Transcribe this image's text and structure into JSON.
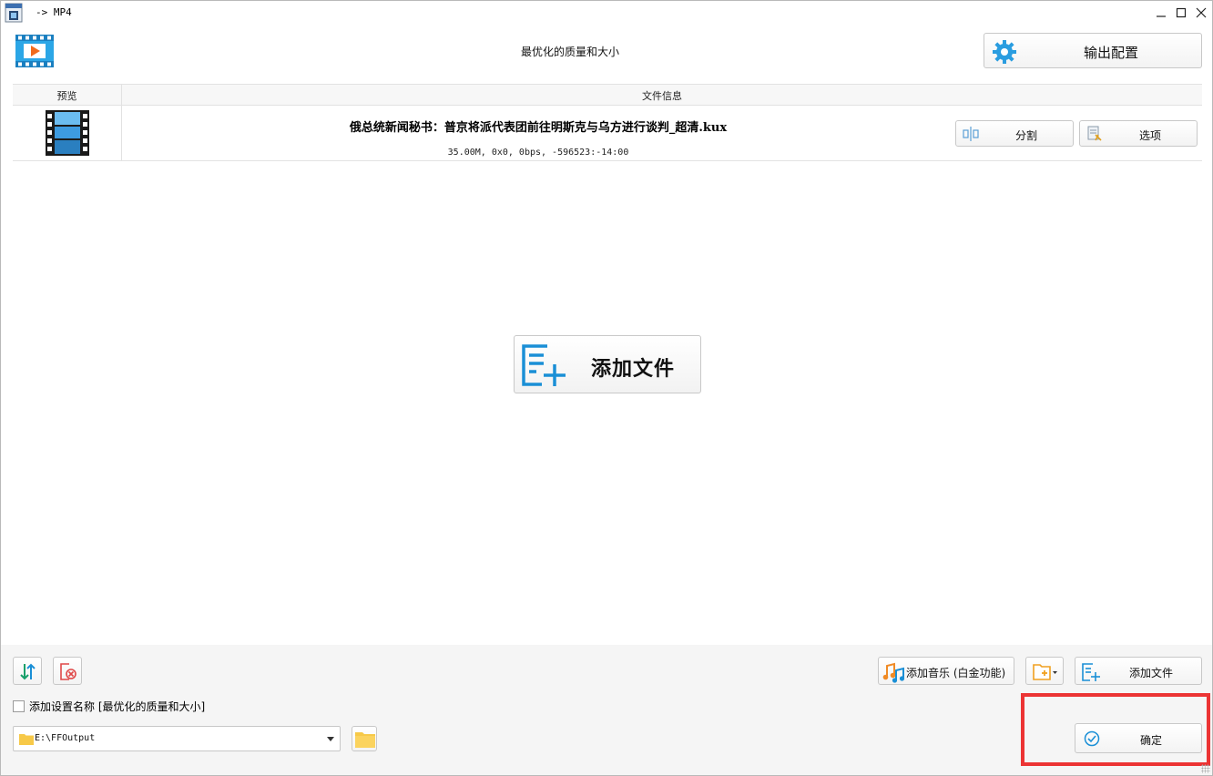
{
  "window": {
    "title": "-> MP4"
  },
  "header": {
    "preset_name": "最优化的质量和大小",
    "output_config_label": "输出配置"
  },
  "table": {
    "columns": [
      "预览",
      "文件信息"
    ],
    "rows": [
      {
        "file_name": "俄总统新闻秘书：普京将派代表团前往明斯克与乌方进行谈判_超清.kux",
        "meta": "35.00M, 0x0, 0bps, -596523:-14:00",
        "split_label": "分割",
        "option_label": "选项"
      }
    ]
  },
  "center": {
    "add_file_label": "添加文件"
  },
  "bottom": {
    "add_music_label": "添加音乐 (白金功能)",
    "add_file_label": "添加文件",
    "add_setting_name_label": "添加设置名称 [最优化的质量和大小]",
    "output_path": "E:\\FFOutput",
    "ok_label": "确定"
  },
  "colors": {
    "accent_blue": "#1a8fd6",
    "folder_yellow": "#f7c948",
    "highlight_red": "#ec3434"
  }
}
